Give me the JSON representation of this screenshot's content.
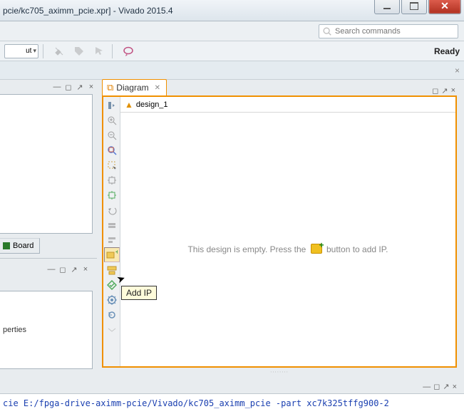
{
  "window": {
    "title": "pcie/kc705_aximm_pcie.xpr] - Vivado 2015.4"
  },
  "search": {
    "placeholder": "Search commands"
  },
  "status": {
    "ready": "Ready"
  },
  "toolbar": {
    "combo": "ut"
  },
  "left": {
    "tab_board": "Board",
    "properties": "perties"
  },
  "diagram": {
    "tab_label": "Diagram",
    "design_name": "design_1",
    "empty_prefix": "This design is empty. Press the",
    "empty_suffix": "button to add IP.",
    "tooltip_addip": "Add IP"
  },
  "console": {
    "tok1": "cie",
    "path": "E:/fpga-drive-aximm-pcie/Vivado/kc705_aximm_pcie -part xc7k325tffg900-2"
  }
}
